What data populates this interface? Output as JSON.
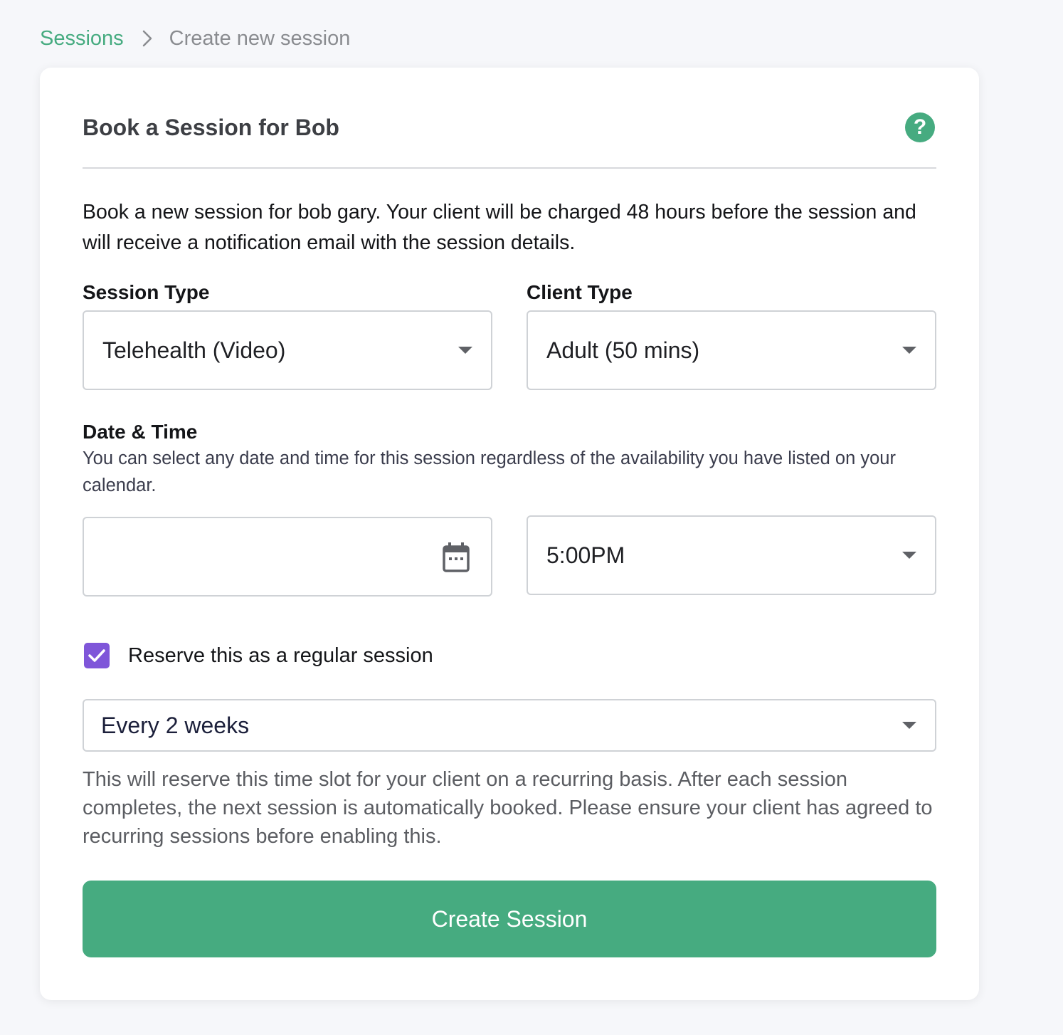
{
  "breadcrumb": {
    "root": "Sessions",
    "current": "Create new session"
  },
  "card": {
    "title": "Book a Session for Bob",
    "help_icon": "question-circle-icon",
    "intro": "Book a new session for bob gary. Your client will be charged 48 hours before the session and will receive a notification email with the session details."
  },
  "session_type": {
    "label": "Session Type",
    "value": "Telehealth (Video)"
  },
  "client_type": {
    "label": "Client Type",
    "value": "Adult (50 mins)"
  },
  "date_time": {
    "label": "Date & Time",
    "helper": "You can select any date and time for this session regardless of the availability you have listed on your calendar.",
    "date_value": "",
    "date_icon": "calendar-icon",
    "time_value": "5:00PM"
  },
  "recurring": {
    "checkbox_label": "Reserve this as a regular session",
    "checked": true,
    "frequency": "Every 2 weeks",
    "note": "This will reserve this time slot for your client on a recurring basis. After each session completes, the next session is automatically booked. Please ensure your client has agreed to recurring sessions before enabling this."
  },
  "submit_label": "Create Session",
  "colors": {
    "accent": "#46ab80",
    "checkbox": "#7f56d9",
    "background": "#f6f7fa"
  }
}
